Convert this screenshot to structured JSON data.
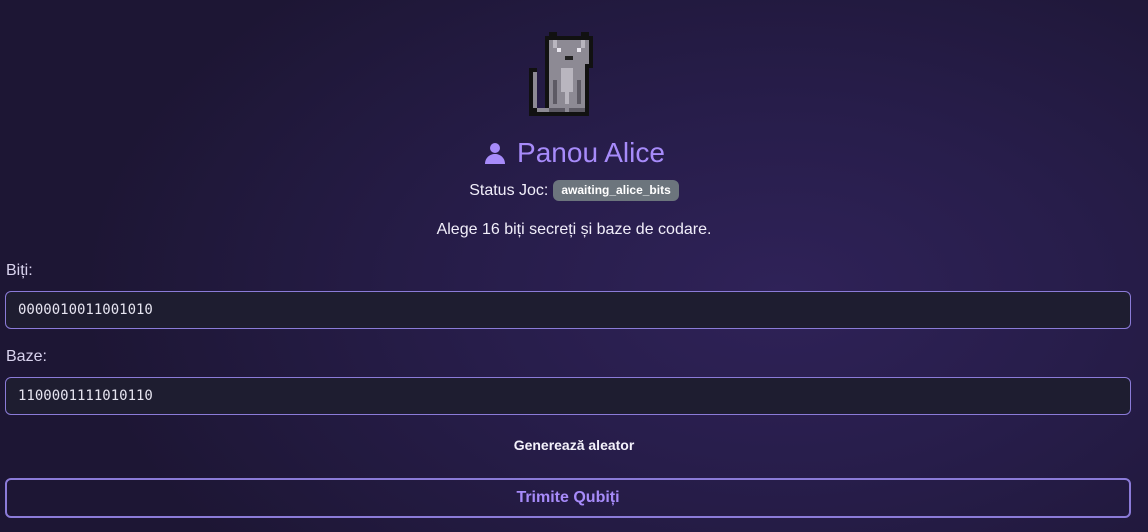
{
  "mascot": {
    "icon": "pixel-cat-icon"
  },
  "header": {
    "title": "Panou Alice",
    "icon": "user-icon",
    "accent_color": "#a78bfa"
  },
  "status": {
    "label": "Status Joc:",
    "badge": "awaiting_alice_bits",
    "badge_color": "#6c757d"
  },
  "instruction": "Alege 16 biți secreți și baze de codare.",
  "form": {
    "bits_label": "Biți:",
    "bits_value": "0000010011001010",
    "bases_label": "Baze:",
    "bases_value": "1100001111010110",
    "generate_label": "Generează aleator",
    "submit_label": "Trimite Qubiți"
  }
}
